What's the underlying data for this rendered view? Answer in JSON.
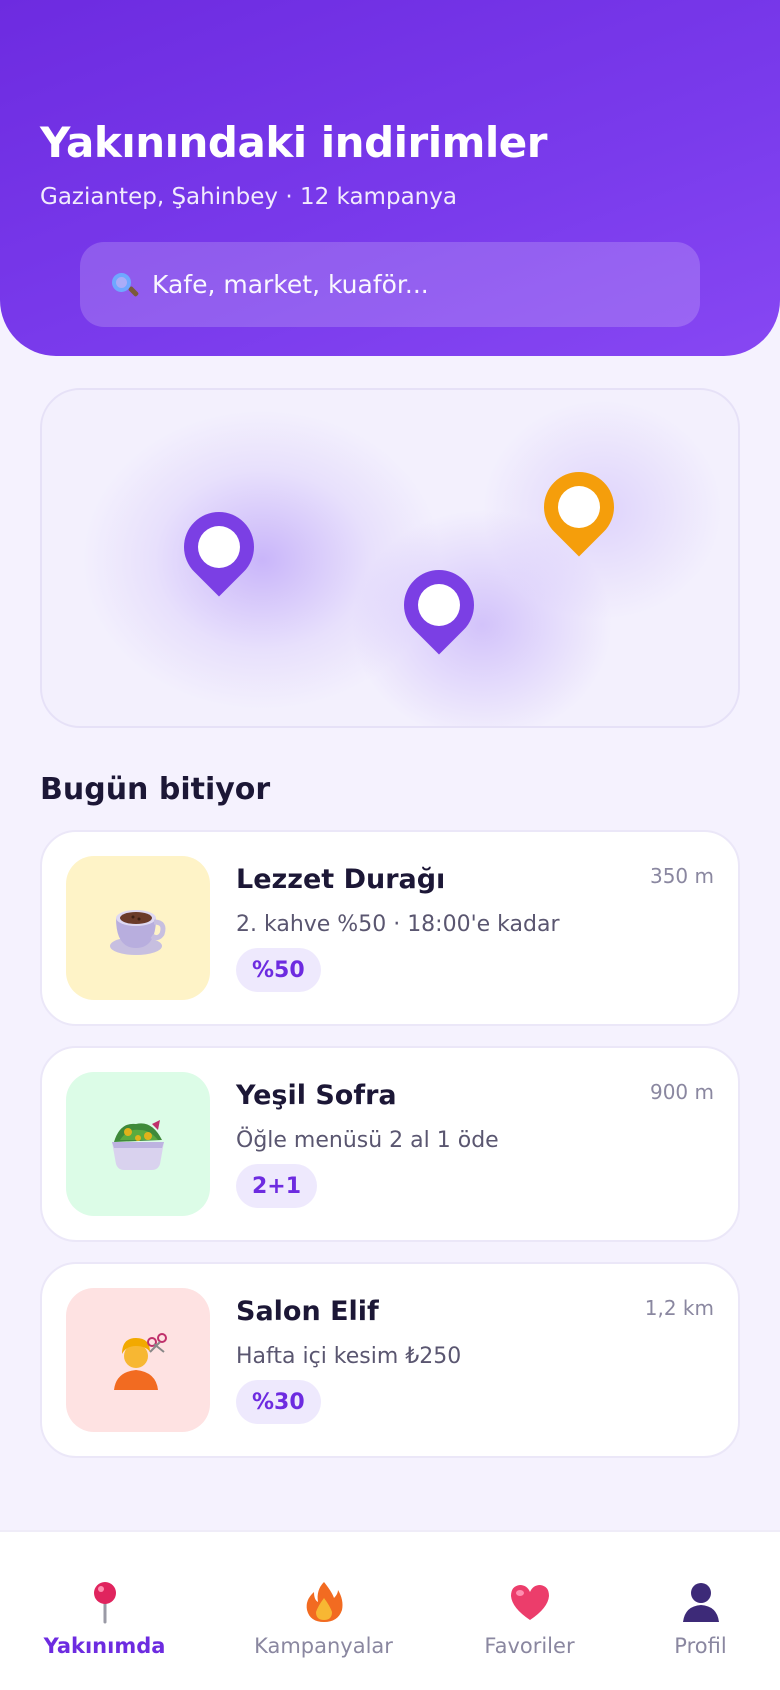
{
  "header": {
    "title": "Yakınındaki indirimler",
    "subtitle": "Gaziantep, Şahinbey · 12 kampanya",
    "search_placeholder": "Kafe, market, kuaför..."
  },
  "map": {
    "pins": [
      {
        "color": "#7b3fe4"
      },
      {
        "color": "#7b3fe4"
      },
      {
        "color": "#f59e0b"
      }
    ]
  },
  "section": {
    "title": "Bugün bitiyor"
  },
  "deals": [
    {
      "name": "Lezzet Durağı",
      "description": "2. kahve %50 · 18:00'e kadar",
      "distance": "350 m",
      "badge": "%50",
      "icon": "coffee-cup-icon",
      "bg": "#fef3c7"
    },
    {
      "name": "Yeşil Sofra",
      "description": "Öğle menüsü 2 al 1 öde",
      "distance": "900 m",
      "badge": "2+1",
      "icon": "salad-bowl-icon",
      "bg": "#dcfce7"
    },
    {
      "name": "Salon Elif",
      "description": "Hafta içi kesim ₺250",
      "distance": "1,2 km",
      "badge": "%30",
      "icon": "haircut-person-icon",
      "bg": "#fee2e2"
    }
  ],
  "nav": {
    "items": [
      {
        "label": "Yakınımda",
        "icon": "map-pin-icon",
        "active": true
      },
      {
        "label": "Kampanyalar",
        "icon": "fire-icon",
        "active": false
      },
      {
        "label": "Favoriler",
        "icon": "heart-icon",
        "active": false
      },
      {
        "label": "Profil",
        "icon": "person-icon",
        "active": false
      }
    ]
  },
  "colors": {
    "brand": "#6d2be0",
    "accent_orange": "#f59e0b",
    "background": "#f5f2fe"
  }
}
